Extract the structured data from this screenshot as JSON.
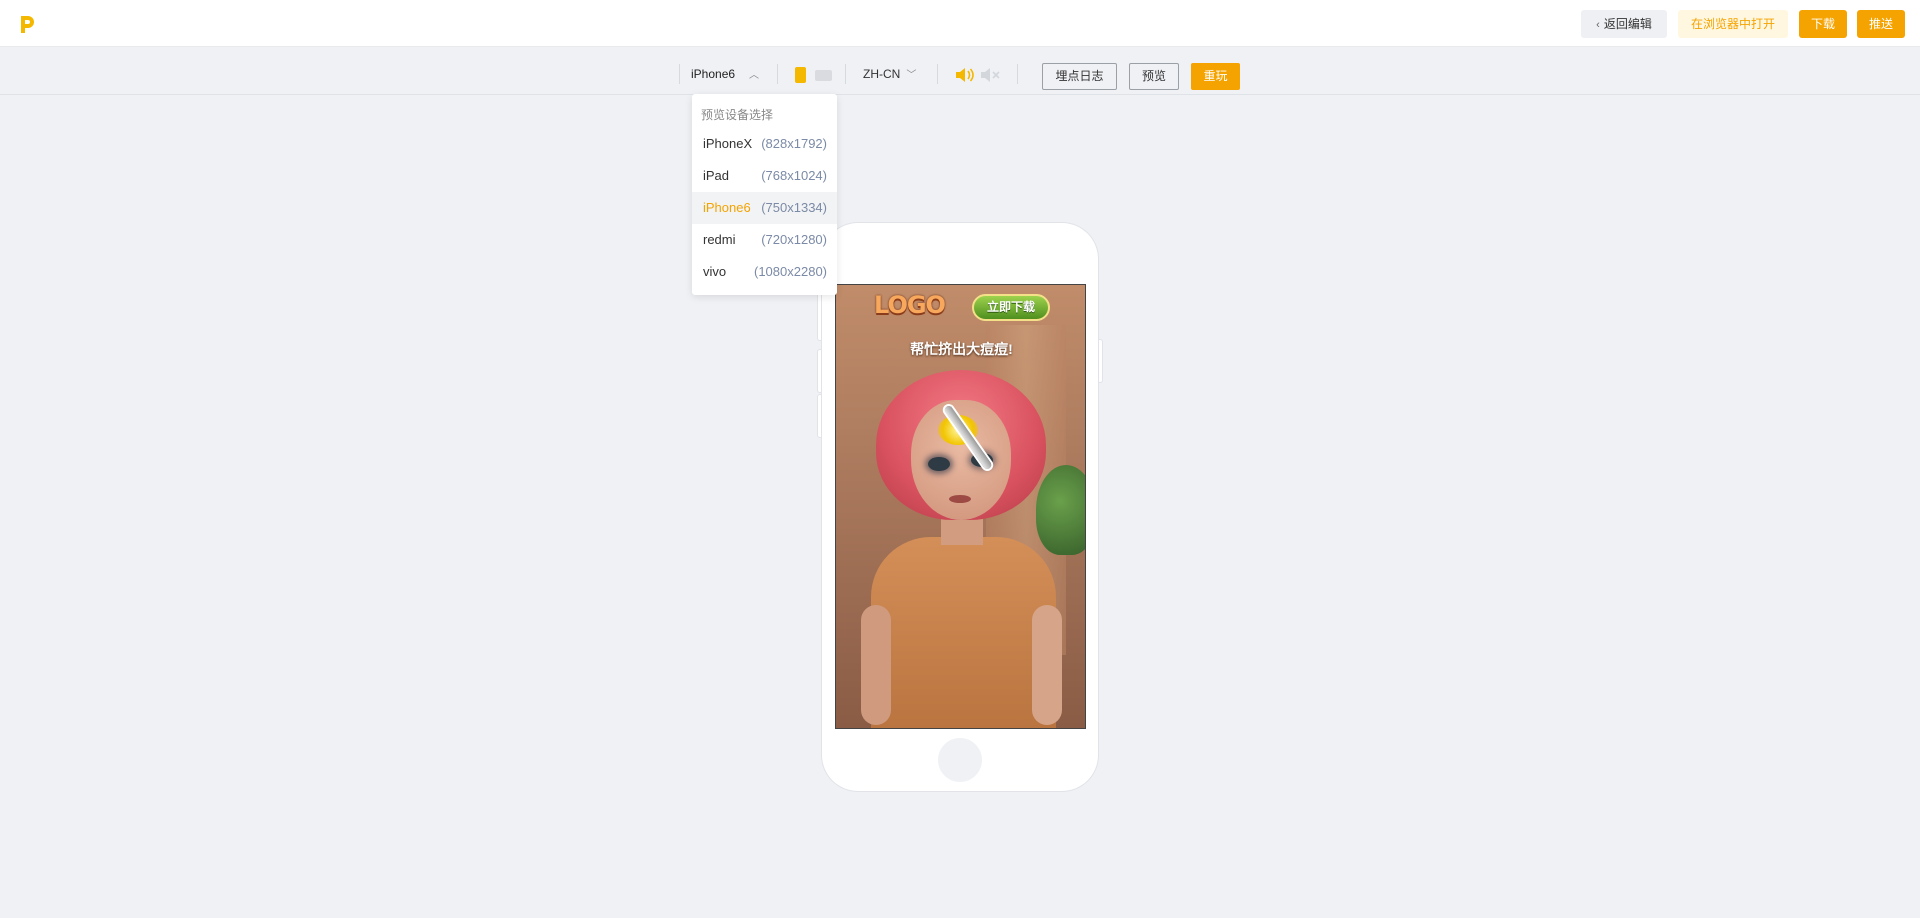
{
  "header": {
    "logo_icon": "p-logo-icon",
    "back_label": "返回编辑",
    "open_browser_label": "在浏览器中打开",
    "download_label": "下载",
    "push_label": "推送",
    "accent_color": "#f5a300"
  },
  "toolbar": {
    "device_selected": "iPhone6",
    "language_selected": "ZH-CN",
    "log_label": "埋点日志",
    "preview_label": "预览",
    "replay_label": "重玩"
  },
  "dropdown": {
    "title": "预览设备选择",
    "items": [
      {
        "name": "iPhoneX",
        "res": "(828x1792)"
      },
      {
        "name": "iPad",
        "res": "(768x1024)"
      },
      {
        "name": "iPhone6",
        "res": "(750x1334)",
        "active": true
      },
      {
        "name": "redmi",
        "res": "(720x1280)"
      },
      {
        "name": "vivo",
        "res": "(1080x2280)"
      }
    ]
  },
  "game": {
    "logo_text": "LOGO",
    "download_label": "立即下载",
    "caption": "帮忙挤出大痘痘!"
  }
}
